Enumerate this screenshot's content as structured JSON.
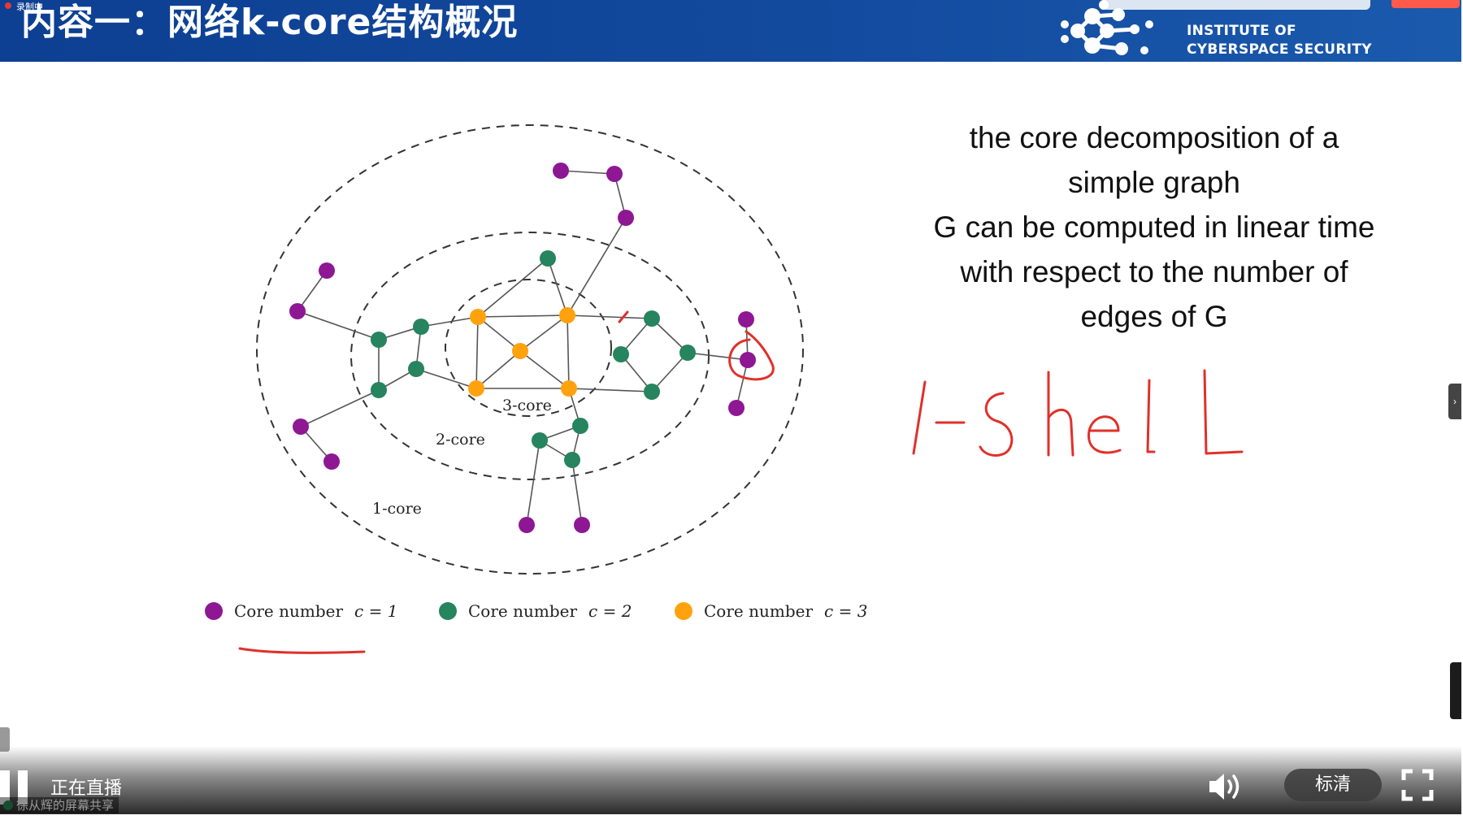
{
  "slide": {
    "title": "内容一：网络k-core结构概况",
    "recording_label": "录制中",
    "institute_line1": "INSTITUTE OF",
    "institute_line2": "CYBERSPACE SECURITY"
  },
  "graph": {
    "labels": {
      "core3": "3-core",
      "core2": "2-core",
      "core1": "1-core"
    },
    "colors": {
      "core1": "#8e1794",
      "core2": "#26845e",
      "core3": "#ffa20d"
    }
  },
  "legend": [
    {
      "text": "Core number",
      "eq": "c = 1",
      "color": "#8e1794"
    },
    {
      "text": "Core number",
      "eq": "c = 2",
      "color": "#26845e"
    },
    {
      "text": "Core number",
      "eq": "c = 3",
      "color": "#ffa20d"
    }
  ],
  "description": {
    "lines": [
      "the core decomposition of a",
      "simple graph",
      "G can be computed in linear time",
      "with respect to the number of",
      "edges of G"
    ]
  },
  "annotation": {
    "handwriting": "1-shell",
    "ink_color": "#e0302a"
  },
  "player": {
    "status": "正在直播",
    "share_label": "徐从辉的屏幕共享",
    "quality": "标清",
    "icons": [
      "pause-icon",
      "volume-icon",
      "fullscreen-icon"
    ]
  }
}
